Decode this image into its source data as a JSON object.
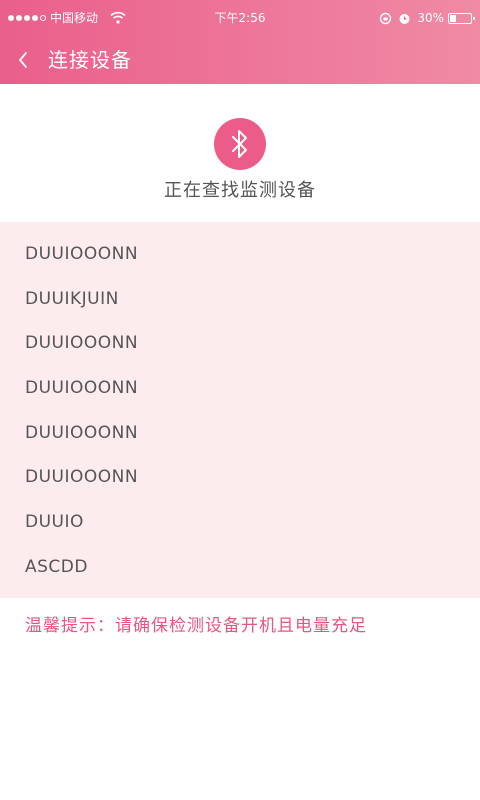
{
  "status_bar": {
    "carrier": "中国移动",
    "time": "下午2:56",
    "battery": "30%",
    "battery_level": 0.3
  },
  "nav": {
    "back_symbol": "‹",
    "title": "连接设备"
  },
  "search": {
    "icon": "bluetooth-icon",
    "status": "正在查找监测设备"
  },
  "devices": [
    "DUUIOOONN",
    "DUUIKJUIN",
    "DUUIOOONN",
    "DUUIOOONN",
    "DUUIOOONN",
    "DUUIOOONN",
    "DUUIO",
    "ASCDD"
  ],
  "tip": "温馨提示：请确保检测设备开机且电量充足",
  "colors": {
    "accent": "#ea5f8b",
    "accent_light": "#f08aa5",
    "list_bg": "#fdecee",
    "tip_text": "#e9557f"
  }
}
